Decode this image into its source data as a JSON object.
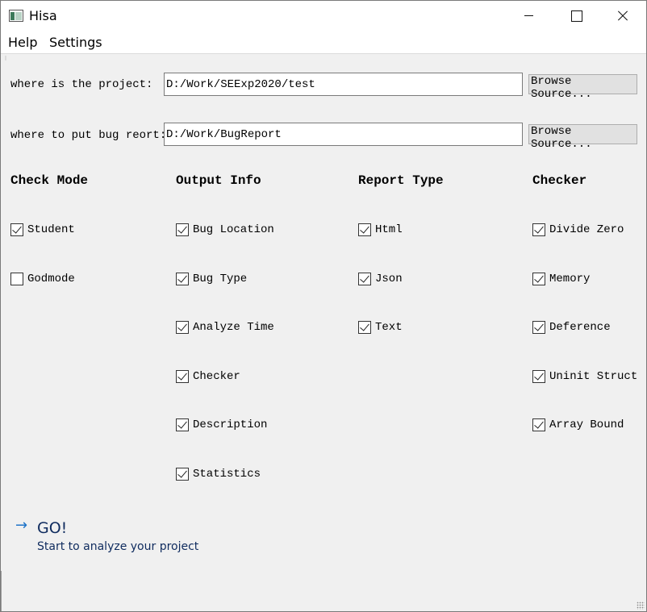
{
  "window": {
    "title": "Hisa"
  },
  "menu": {
    "items": [
      "Help",
      "Settings"
    ]
  },
  "form": {
    "project_label": "where is the project:",
    "project_value": "D:/Work/SEExp2020/test",
    "report_label": "where to put bug reort:",
    "report_value": "D:/Work/BugReport",
    "browse_label": "Browse Source..."
  },
  "columns": [
    {
      "title": "Check Mode",
      "options": [
        {
          "label": "Student",
          "checked": true
        },
        {
          "label": "Godmode",
          "checked": false
        }
      ]
    },
    {
      "title": "Output Info",
      "options": [
        {
          "label": "Bug Location",
          "checked": true
        },
        {
          "label": "Bug Type",
          "checked": true
        },
        {
          "label": "Analyze Time",
          "checked": true
        },
        {
          "label": "Checker",
          "checked": true
        },
        {
          "label": "Description",
          "checked": true
        },
        {
          "label": "Statistics",
          "checked": true
        }
      ]
    },
    {
      "title": "Report Type",
      "options": [
        {
          "label": "Html",
          "checked": true
        },
        {
          "label": "Json",
          "checked": true
        },
        {
          "label": "Text",
          "checked": true
        }
      ]
    },
    {
      "title": "Checker",
      "options": [
        {
          "label": "Divide Zero",
          "checked": true
        },
        {
          "label": "Memory",
          "checked": true
        },
        {
          "label": "Deference",
          "checked": true
        },
        {
          "label": "Uninit Struct",
          "checked": true
        },
        {
          "label": "Array Bound",
          "checked": true
        }
      ]
    }
  ],
  "go": {
    "arrow": "→",
    "title": "GO!",
    "subtitle": "Start to analyze your project"
  },
  "colors": {
    "accent": "#1e73c8",
    "link_text": "#0f2b5e"
  }
}
